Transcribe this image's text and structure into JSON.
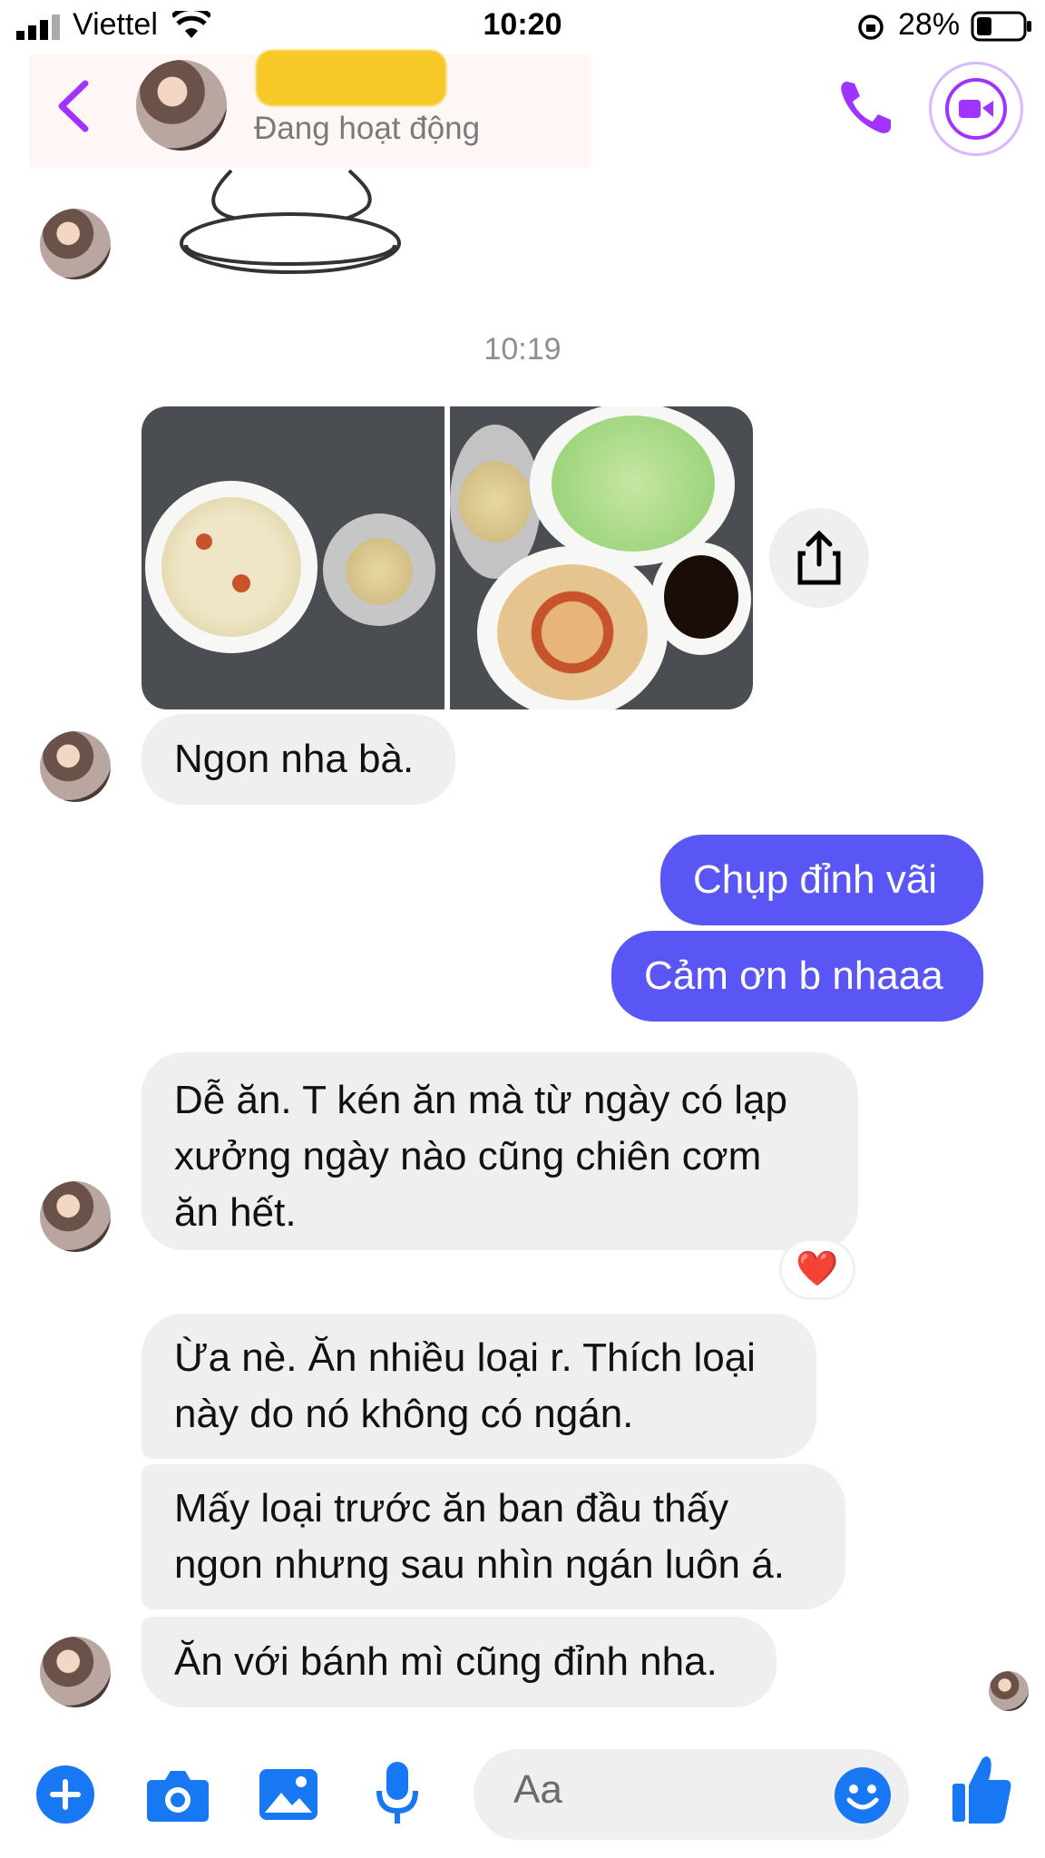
{
  "status_bar": {
    "carrier": "Viettel",
    "time": "10:20",
    "battery": "28%"
  },
  "header": {
    "status_text": "Đang hoạt động"
  },
  "thread": {
    "timestamp": "10:19",
    "messages": [
      {
        "from": "them",
        "text": "Ngon nha bà."
      },
      {
        "from": "me",
        "text": "Chụp đỉnh vãi"
      },
      {
        "from": "me",
        "text": "Cảm ơn b nhaaa"
      },
      {
        "from": "them",
        "lines": [
          "Dễ ăn. T kén ăn mà từ ngày có lạp",
          "xưởng ngày nào cũng chiên cơm",
          "ăn hết."
        ],
        "reaction": "❤️"
      },
      {
        "from": "them",
        "lines": [
          "Ừa nè. Ăn nhiều loại r. Thích loại",
          "này do nó không có ngán."
        ]
      },
      {
        "from": "them",
        "lines": [
          "Mấy loại trước ăn ban đầu thấy",
          "ngon nhưng sau nhìn ngán luôn á."
        ]
      },
      {
        "from": "them",
        "text": "Ăn với bánh mì cũng đỉnh nha."
      }
    ]
  },
  "composer": {
    "placeholder": "Aa"
  },
  "colors": {
    "accent": "#a033ff",
    "outgoing": "#5a55f5",
    "composer_blue": "#1877f2"
  }
}
